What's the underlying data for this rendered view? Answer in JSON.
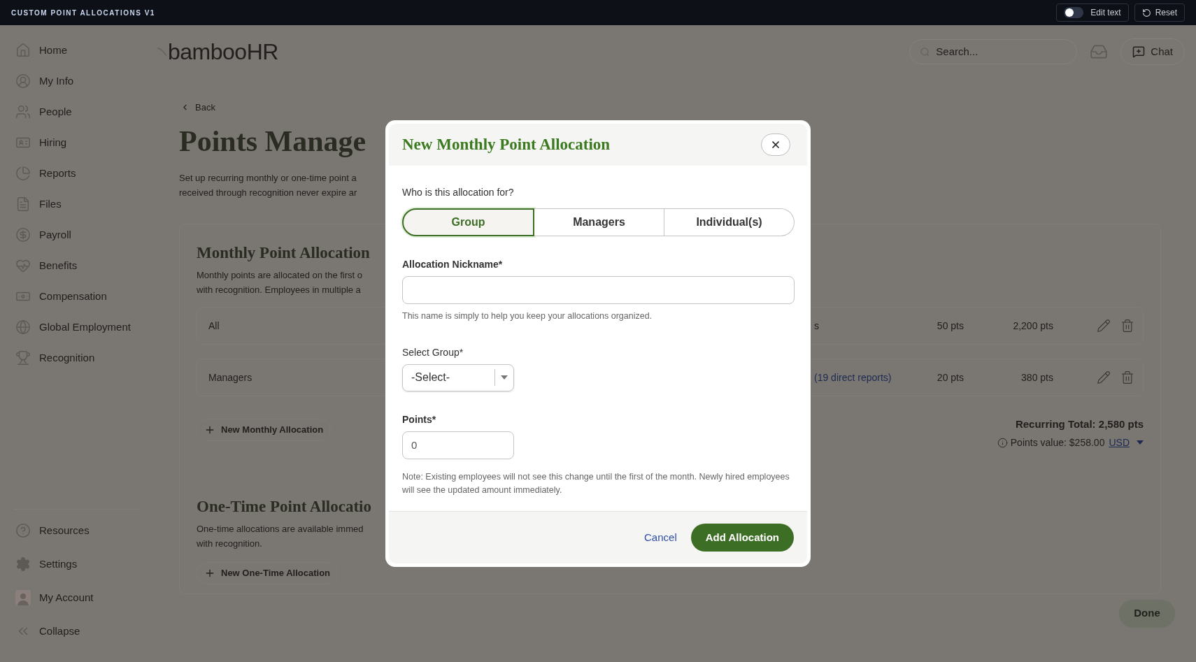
{
  "top_bar": {
    "title": "CUSTOM POINT ALLOCATIONS V1",
    "edit_text": {
      "label": "Edit text",
      "on": false
    },
    "reset": "Reset"
  },
  "sidebar": {
    "items": [
      {
        "label": "Home"
      },
      {
        "label": "My Info"
      },
      {
        "label": "People"
      },
      {
        "label": "Hiring"
      },
      {
        "label": "Reports"
      },
      {
        "label": "Files"
      },
      {
        "label": "Payroll"
      },
      {
        "label": "Benefits"
      },
      {
        "label": "Compensation"
      },
      {
        "label": "Global Employment"
      },
      {
        "label": "Recognition"
      }
    ],
    "bottom_items": [
      {
        "label": "Resources"
      },
      {
        "label": "Settings"
      },
      {
        "label": "My Account"
      },
      {
        "label": "Collapse"
      }
    ]
  },
  "header": {
    "logo": "bambooHR",
    "search": {
      "placeholder": "Search..."
    },
    "chat": "Chat"
  },
  "page": {
    "back": "Back",
    "title": "Points Manage",
    "description": [
      "Set up recurring monthly or one-time point a",
      "received through recognition never expire ar"
    ],
    "monthly": {
      "title": "Monthly Point Allocation",
      "description": [
        "Monthly points are allocated on the first o",
        "with recognition. Employees in multiple a"
      ],
      "rows": [
        {
          "name": "All",
          "audience": "s",
          "link": false,
          "points": "50 pts",
          "total": "2,200 pts"
        },
        {
          "name": "Managers",
          "audience": "(19 direct reports)",
          "link": true,
          "points": "20 pts",
          "total": "380 pts"
        }
      ],
      "new_button": "New Monthly Allocation",
      "recurring_total": "Recurring Total: 2,580 pts",
      "points_value": "Points value: $258.00",
      "currency": "USD"
    },
    "one_time": {
      "title": "One-Time Point Allocatio",
      "description": [
        "One-time allocations are available immed",
        "with recognition."
      ],
      "new_button": "New One-Time Allocation"
    },
    "done": {
      "label": "Done",
      "disabled": true
    }
  },
  "modal": {
    "title": "New Monthly Point Allocation",
    "question": "Who is this allocation for?",
    "options": [
      {
        "label": "Group",
        "selected": true
      },
      {
        "label": "Managers",
        "selected": false
      },
      {
        "label": "Individual(s)",
        "selected": false
      }
    ],
    "nickname": {
      "label": "Allocation Nickname*",
      "hint": "This name is simply to help you keep your allocations organized."
    },
    "group": {
      "label": "Select Group*",
      "value": "-Select-"
    },
    "points": {
      "label": "Points*",
      "value": "0"
    },
    "note": "Note: Existing employees will not see this change until the first of the month. Newly hired employees will see the updated amount immediately.",
    "cancel": "Cancel",
    "submit": "Add Allocation"
  }
}
